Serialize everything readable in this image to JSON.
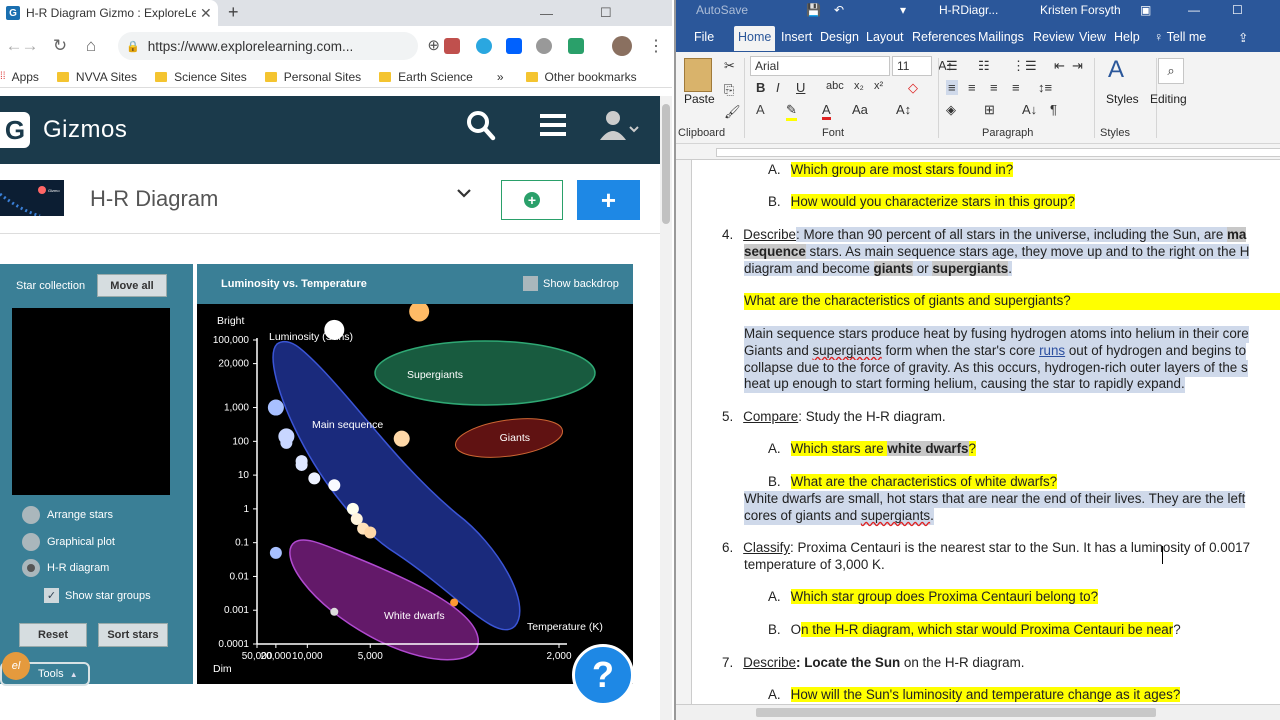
{
  "browser": {
    "tab_title": "H-R Diagram Gizmo : ExploreLea",
    "tab_favicon": "G",
    "url": "https://www.explorelearning.com...",
    "bookmarks": [
      "Apps",
      "NVVA Sites",
      "Science Sites",
      "Personal Sites",
      "Earth Science"
    ],
    "bookmarks_more": "»",
    "other_bookmarks": "Other bookmarks",
    "colors": {
      "header": "#1b3a4b",
      "panel": "#3a7f96",
      "accent_blue": "#1e88e5",
      "accent_green": "#2aa06a"
    }
  },
  "gizmos": {
    "logo_letter": "G",
    "brand": "Gizmos",
    "title": "H-R Diagram",
    "thumb_label": "Gizmo",
    "add_icon": "+",
    "blue_icon": "+",
    "help_icon": "?",
    "panel": {
      "star_collection": "Star collection",
      "move_all": "Move all",
      "options": [
        "Arrange stars",
        "Graphical plot",
        "H-R diagram"
      ],
      "selected_option": 2,
      "show_star_groups": "Show star groups",
      "checkmark": "✓",
      "reset": "Reset",
      "sort_stars": "Sort stars",
      "tools": "Tools",
      "tools_caret": "▲",
      "logo": "el"
    },
    "chart_header": {
      "title": "Luminosity vs. Temperature",
      "show_backdrop": "Show backdrop"
    }
  },
  "chart_data": {
    "type": "scatter",
    "title": "Luminosity vs. Temperature",
    "ylabel": "Luminosity (Suns)",
    "xlabel": "Temperature (K)",
    "y_top_label": "Bright",
    "y_bottom_label": "Dim",
    "x_scale": "reciprocal",
    "y_scale": "log",
    "xlim": [
      50000,
      2000
    ],
    "ylim": [
      0.0001,
      100000
    ],
    "x_ticks": [
      50000,
      20000,
      10000,
      5000,
      2000
    ],
    "x_tick_labels": [
      "50,000",
      "20,000",
      "10,000",
      "5,000",
      "2,000"
    ],
    "y_ticks": [
      0.0001,
      0.001,
      0.01,
      0.1,
      1,
      10,
      100,
      1000,
      20000,
      100000
    ],
    "y_tick_labels": [
      "0.0001",
      "0.001",
      "0.01",
      "0.1",
      "1",
      "10",
      "100",
      "1,000",
      "20,000",
      "100,000"
    ],
    "grid": false,
    "groups": [
      {
        "label": "Supergiants",
        "color": "#1c6b4a"
      },
      {
        "label": "Giants",
        "color": "#8a1a1a"
      },
      {
        "label": "Main sequence",
        "color": "#23369c"
      },
      {
        "label": "White dwarfs",
        "color": "#8a2a8c"
      }
    ],
    "points": [
      {
        "temp": 20000,
        "lum": 1000,
        "color": "#a8c0ff"
      },
      {
        "temp": 15000,
        "lum": 140,
        "color": "#c8d6ff"
      },
      {
        "temp": 15000,
        "lum": 90,
        "color": "#c8d6ff"
      },
      {
        "temp": 11000,
        "lum": 26,
        "color": "#dde6ff"
      },
      {
        "temp": 11000,
        "lum": 20,
        "color": "#dde6ff"
      },
      {
        "temp": 9000,
        "lum": 8,
        "color": "#eef2ff"
      },
      {
        "temp": 7000,
        "lum": 5,
        "color": "#fafaff"
      },
      {
        "temp": 5800,
        "lum": 1,
        "color": "#ffffee"
      },
      {
        "temp": 5600,
        "lum": 0.5,
        "color": "#fff4dd"
      },
      {
        "temp": 5300,
        "lum": 0.26,
        "color": "#ffe2bb"
      },
      {
        "temp": 5000,
        "lum": 0.2,
        "color": "#ffd8a8"
      },
      {
        "temp": 7000,
        "lum": 200000,
        "color": "#ffffff"
      },
      {
        "temp": 3600,
        "lum": 700000,
        "color": "#ffbb66"
      },
      {
        "temp": 4000,
        "lum": 120,
        "color": "#ffd8a8"
      },
      {
        "temp": 20000,
        "lum": 0.05,
        "color": "#a8c0ff"
      },
      {
        "temp": 7000,
        "lum": 0.0009,
        "color": "#dddddd"
      },
      {
        "temp": 3000,
        "lum": 0.0017,
        "color": "#ff9933"
      }
    ]
  },
  "word": {
    "autosave": "AutoSave",
    "doc_title": "H-RDiagr...",
    "user": "Kristen Forsyth",
    "tabs": [
      "File",
      "Home",
      "Insert",
      "Design",
      "Layout",
      "References",
      "Mailings",
      "Review",
      "View",
      "Help",
      "Tell me"
    ],
    "active_tab": "Home",
    "ribbon": {
      "paste": "Paste",
      "font": "Arial",
      "size": "11",
      "styles": "Styles",
      "editing": "Editing",
      "groups": [
        "Clipboard",
        "Font",
        "Paragraph",
        "Styles"
      ]
    },
    "doc": {
      "q3a_label": "A.",
      "q3a": "Which group are most stars found in?",
      "q3b_label": "B.",
      "q3b": "How would you characterize stars in this group?",
      "q4_num": "4.",
      "q4_head": "Describe",
      "q4_l1a": ": More than 90 percent of all stars in the universe, including the Sun, are ",
      "q4_l1b": "ma",
      "q4_l2a": "sequence",
      "q4_l2b": " stars. As main sequence stars age, they move up and to the right on the H",
      "q4_l3a": "diagram and become ",
      "q4_l3b": "giants",
      "q4_l3c": " or ",
      "q4_l3d": "supergiants",
      "q4_l3e": ".",
      "q4_q": "What are the characteristics of giants and supergiants?",
      "q4_ans1": "Main sequence stars produce heat by fusing hydrogen atoms into helium in their core",
      "q4_ans2a": "Giants and ",
      "q4_ans2b": "supergiants",
      "q4_ans2c": " form when the star's core ",
      "q4_ans2d": "runs",
      "q4_ans2e": " out of hydrogen and begins to",
      "q4_ans3": "collapse due to the force of gravity. As this occurs, hydrogen-rich outer layers of the s",
      "q4_ans4": "heat up enough to start forming helium, causing the star to rapidly expand.",
      "q5_num": "5.",
      "q5_head": "Compare",
      "q5_text": ": Study the H-R diagram.",
      "q5a_label": "A.",
      "q5a_pre": "Which stars are ",
      "q5a_bold": "white dwarfs",
      "q5a_post": "?",
      "q5b_label": "B.",
      "q5b": "What are the characteristics of white dwarfs?",
      "q5_ans1": "White dwarfs are small, hot stars that are near the end of their lives. They are the left",
      "q5_ans2a": "cores of giants and ",
      "q5_ans2b": "supergiants",
      "q5_ans2c": ".",
      "q6_num": "6.",
      "q6_head": "Classify",
      "q6_l1": ": Proxima Centauri is the nearest star to the Sun. It has a luminosity of 0.0017",
      "q6_l2": "temperature of 3,000 K.",
      "q6a_label": "A.",
      "q6a": "Which star group does Proxima Centauri belong to?",
      "q6b_label": "B.",
      "q6b_pre": "O",
      "q6b": "n the H-R diagram, which star would Proxima Centauri be near",
      "q6b_post": "?",
      "q7_num": "7.",
      "q7_head": "Describe",
      "q7_bold": ": Locate the Sun",
      "q7_text": " on the H-R diagram.",
      "q7a_label": "A.",
      "q7a": "How will the Sun's luminosity and temperature change as it ages?"
    }
  }
}
